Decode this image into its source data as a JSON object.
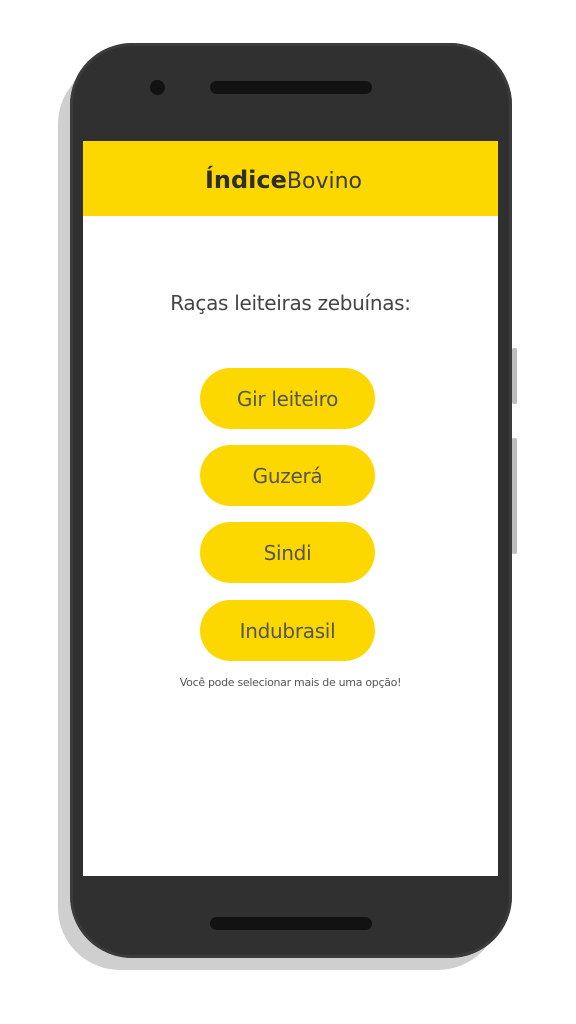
{
  "app": {
    "brand_bold": "Índice",
    "brand_light": "Bovino",
    "accent_color": "#fdd800"
  },
  "screen": {
    "heading": "Raças leiteiras zebuínas:",
    "options": [
      {
        "label": "Gir leiteiro"
      },
      {
        "label": "Guzerá"
      },
      {
        "label": "Sindi"
      },
      {
        "label": "Indubrasil"
      }
    ],
    "hint": "Você pode selecionar mais de uma opção!"
  }
}
